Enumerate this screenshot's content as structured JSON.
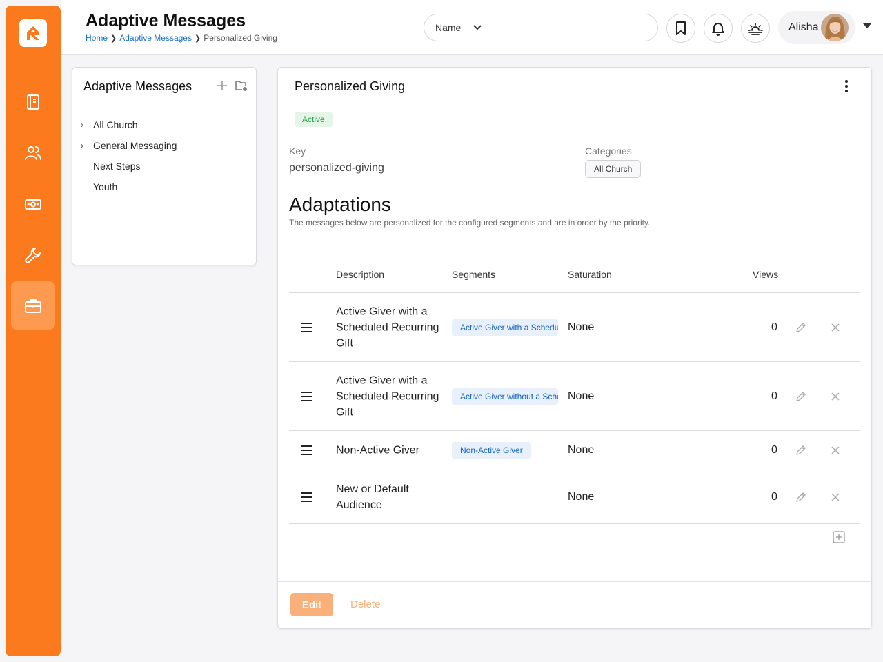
{
  "header": {
    "title": "Adaptive Messages",
    "breadcrumb": [
      "Home",
      "Adaptive Messages",
      "Personalized Giving"
    ],
    "search": {
      "filter_label": "Name",
      "placeholder": "",
      "value": ""
    },
    "user": {
      "name": "Alisha"
    }
  },
  "sidebar": {
    "items": [
      {
        "icon": "notebook-icon",
        "active": false
      },
      {
        "icon": "people-icon",
        "active": false
      },
      {
        "icon": "money-icon",
        "active": false
      },
      {
        "icon": "wrench-icon",
        "active": false
      },
      {
        "icon": "briefcase-icon",
        "active": true
      }
    ]
  },
  "tree": {
    "title": "Adaptive Messages",
    "items": [
      {
        "label": "All Church",
        "expandable": true
      },
      {
        "label": "General Messaging",
        "expandable": true
      },
      {
        "label": "Next Steps",
        "expandable": false
      },
      {
        "label": "Youth",
        "expandable": false
      }
    ]
  },
  "detail": {
    "title": "Personalized Giving",
    "status": "Active",
    "key_label": "Key",
    "key_value": "personalized-giving",
    "categories_label": "Categories",
    "category": "All Church"
  },
  "adaptations": {
    "title": "Adaptations",
    "description": "The messages below are personalized for the configured segments and are in order by the priority.",
    "columns": [
      "Description",
      "Segments",
      "Saturation",
      "Views"
    ],
    "rows": [
      {
        "description": "Active Giver with a Scheduled Recurring Gift",
        "segment": "Active Giver with a Scheduled Recurring Gift",
        "saturation": "None",
        "views": "0"
      },
      {
        "description": "Active Giver with a Scheduled Recurring Gift",
        "segment": "Active Giver without a Scheduled Recurring Gift",
        "saturation": "None",
        "views": "0"
      },
      {
        "description": "Non-Active Giver",
        "segment": "Non-Active Giver",
        "saturation": "None",
        "views": "0"
      },
      {
        "description": "New or Default Audience",
        "segment": "",
        "saturation": "None",
        "views": "0"
      }
    ]
  },
  "footer": {
    "edit_label": "Edit",
    "delete_label": "Delete"
  },
  "colors": {
    "brand": "#fb7a1e",
    "active_nav": "#fd9a50",
    "link": "#1a6fc9",
    "success": "#1f9d45"
  }
}
